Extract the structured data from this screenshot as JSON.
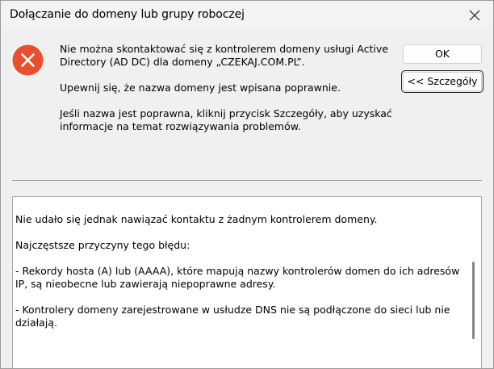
{
  "window": {
    "title": "Dołączanie do domeny lub grupy roboczej"
  },
  "message": {
    "line1": "Nie można skontaktować się z kontrolerem domeny usługi Active Directory (AD DC) dla domeny „CZEKAJ.COM.PL”.",
    "line2": "Upewnij się, że nazwa domeny jest wpisana poprawnie.",
    "line3": "Jeśli nazwa jest poprawna, kliknij przycisk Szczegóły, aby uzyskać informacje na temat rozwiązywania problemów."
  },
  "buttons": {
    "ok": "OK",
    "details": "<< Szczegóły"
  },
  "details": {
    "p1": "Nie udało się jednak nawiązać kontaktu z żadnym kontrolerem domeny.",
    "p2": "Najczęstsze przyczyny tego błędu:",
    "p3": "- Rekordy hosta (A) lub (AAAA), które mapują nazwy kontrolerów domen do ich adresów IP, są nieobecne lub zawierają niepoprawne adresy.",
    "p4": "- Kontrolery domeny zarejestrowane w usłudze DNS nie są podłączone do sieci lub nie działają."
  },
  "colors": {
    "error_icon": "#e8502f",
    "dialog_bg": "#f0f0f0"
  },
  "icons": {
    "error": "error-x-icon",
    "close": "close-icon"
  }
}
